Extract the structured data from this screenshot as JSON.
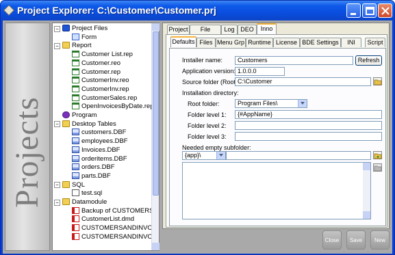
{
  "window": {
    "title": "Project Explorer: C:\\Customer\\Customer.prj"
  },
  "sidepanel": {
    "label": "Projects"
  },
  "tree": [
    {
      "label": "Project Files",
      "icon": "project-icon"
    },
    {
      "label": "Form",
      "icon": "form-icon"
    },
    {
      "label": "Report",
      "icon": "folder-icon"
    },
    {
      "label": "Customer List.rep",
      "icon": "report-icon"
    },
    {
      "label": "Customer.reo",
      "icon": "report-icon"
    },
    {
      "label": "Customer.rep",
      "icon": "report-icon"
    },
    {
      "label": "CustomerInv.reo",
      "icon": "report-icon"
    },
    {
      "label": "CustomerInv.rep",
      "icon": "report-icon"
    },
    {
      "label": "CustomerSales.rep",
      "icon": "report-icon"
    },
    {
      "label": "OpenInvoicesByDate.rep",
      "icon": "report-icon"
    },
    {
      "label": "Program",
      "icon": "program-icon"
    },
    {
      "label": "Desktop Tables",
      "icon": "folder-icon"
    },
    {
      "label": "customers.DBF",
      "icon": "table-icon"
    },
    {
      "label": "employees.DBF",
      "icon": "table-icon"
    },
    {
      "label": "Invoices.DBF",
      "icon": "table-icon"
    },
    {
      "label": "orderitems.DBF",
      "icon": "table-icon"
    },
    {
      "label": "orders.DBF",
      "icon": "table-icon"
    },
    {
      "label": "parts.DBF",
      "icon": "table-icon"
    },
    {
      "label": "SQL",
      "icon": "folder-icon"
    },
    {
      "label": "test.sql",
      "icon": "sql-icon"
    },
    {
      "label": "Datamodule",
      "icon": "folder-icon"
    },
    {
      "label": "Backup of CUSTOMERS",
      "icon": "datamodule-icon"
    },
    {
      "label": "CustomerList.dmd",
      "icon": "datamodule-icon"
    },
    {
      "label": "CUSTOMERSANDINVOI",
      "icon": "datamodule-icon"
    },
    {
      "label": "CUSTOMERSANDINVOI",
      "icon": "datamodule-icon"
    }
  ],
  "outer_tabs": [
    "Project",
    "File Details",
    "Log",
    "DEO",
    "Inno"
  ],
  "inner_tabs": [
    "Defaults",
    "Files",
    "Menu Grp",
    "Runtime",
    "License",
    "BDE Settings",
    "INI",
    "Script"
  ],
  "form": {
    "installer_name_label": "Installer name:",
    "installer_name_value": "Customers",
    "refresh_label": "Refresh",
    "app_version_label": "Application version:",
    "app_version_value": "1.0.0.0",
    "source_folder_label": "Source folder (Root):",
    "source_folder_value": "C:\\Customer",
    "install_dir_label": "Installation directory:",
    "root_folder_label": "Root folder:",
    "root_folder_value": "Program Files\\",
    "level1_label": "Folder level 1:",
    "level1_value": "{#AppName}",
    "level2_label": "Folder level 2:",
    "level2_value": "",
    "level3_label": "Folder level 3:",
    "level3_value": "",
    "needed_label": "Needed empty subfolder:",
    "needed_value": "{app}\\"
  },
  "bottom_buttons": {
    "close": "Close",
    "save": "Save",
    "new": "New"
  },
  "colors": {
    "titlebar": "#0a4ede",
    "active_tab_accent": "#f7b338"
  }
}
